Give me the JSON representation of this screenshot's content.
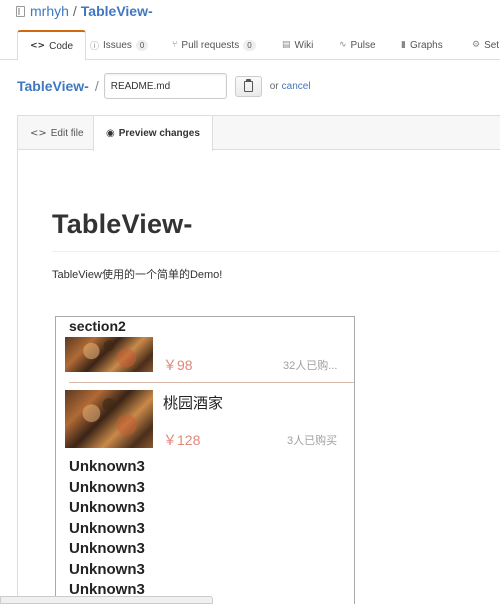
{
  "header": {
    "owner": "mrhyh",
    "separator": "/",
    "repo": "TableView-"
  },
  "nav": {
    "tabs": [
      {
        "label": "Code",
        "icon": "<>",
        "active": true
      },
      {
        "label": "Issues",
        "icon": "ⓘ",
        "count": "0"
      },
      {
        "label": "Pull requests",
        "icon": "⑂",
        "count": "0"
      },
      {
        "label": "Wiki",
        "icon": "▤"
      },
      {
        "label": "Pulse",
        "icon": "∿"
      },
      {
        "label": "Graphs",
        "icon": "▮"
      },
      {
        "label": "Set",
        "icon": "⚙"
      }
    ]
  },
  "file_bar": {
    "repo_link": "TableView-",
    "slash": "/",
    "filename": "README.md",
    "or_text": "or",
    "cancel_label": "cancel"
  },
  "editor_tabs": {
    "edit_label": "Edit file",
    "edit_icon": "<>",
    "preview_label": "Preview changes",
    "preview_icon": "◉"
  },
  "preview": {
    "title": "TableView-",
    "description": "TableView使用的一个简单的Demo!",
    "screenshot": {
      "section_header": "section2",
      "cells": [
        {
          "name": "",
          "price": "￥98",
          "sales": "32人已购..."
        },
        {
          "name": "桃园酒家",
          "price": "￥128",
          "sales": "3人已购买"
        }
      ],
      "unknown_rows": [
        "Unknown3",
        "Unknown3",
        "Unknown3",
        "Unknown3",
        "Unknown3",
        "Unknown3",
        "Unknown3"
      ]
    }
  }
}
